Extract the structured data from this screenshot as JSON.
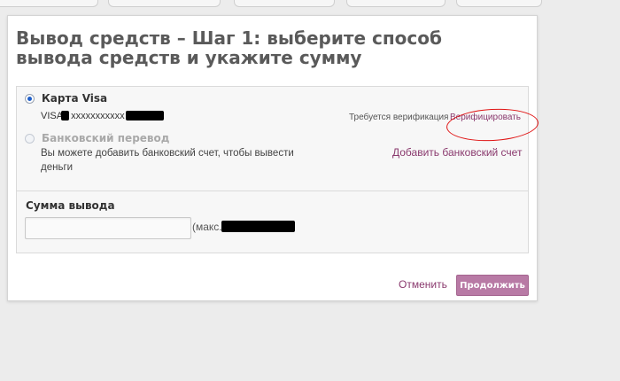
{
  "page": {
    "title": "Вывод средств – Шаг 1: выберите способ вывода средств и укажите сумму"
  },
  "methods": {
    "card": {
      "label": "Карта Visa",
      "number_prefix": "VISA",
      "number_masked": "xxxxxxxxxxx",
      "verification_text": "Требуется верификация",
      "verify_link": "Верифицировать",
      "selected": true
    },
    "bank": {
      "label": "Банковский перевод",
      "description": "Вы можете добавить банковский счет, чтобы вывести деньги",
      "add_link": "Добавить банковский счет",
      "selected": false
    }
  },
  "amount": {
    "label": "Сумма вывода",
    "value": "",
    "max_prefix": "(макс."
  },
  "actions": {
    "cancel": "Отменить",
    "continue": "Продолжить"
  },
  "colors": {
    "accent": "#b87aa5",
    "link": "#8a3a6e",
    "annotation": "#e01414"
  }
}
